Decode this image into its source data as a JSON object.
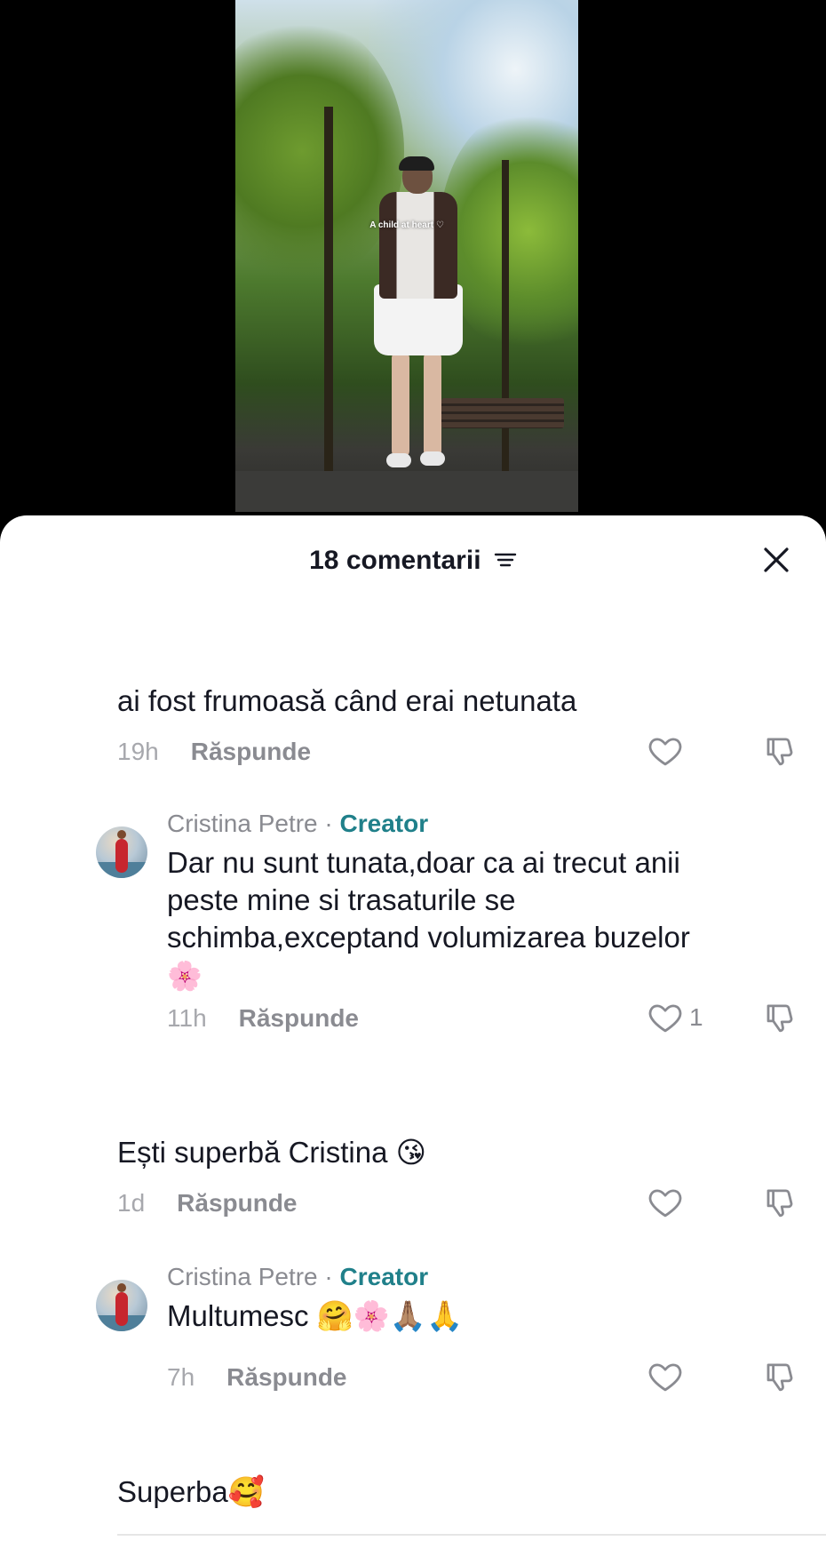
{
  "video": {
    "caption": "A child at heart ♡"
  },
  "sheet": {
    "title": "18 comentarii"
  },
  "comments": [
    {
      "text": "ai fost frumoasă când erai netunata",
      "time": "19h",
      "reply_label": "Răspunde",
      "likes": ""
    },
    {
      "author": "Cristina Petre",
      "badge": "Creator",
      "separator": " · ",
      "text_lines": [
        "Dar nu sunt tunata,doar ca ai trecut anii",
        "peste mine si trasaturile se",
        "schimba,exceptand volumizarea buzelor"
      ],
      "emoji": "🌸",
      "time": "11h",
      "reply_label": "Răspunde",
      "likes": "1"
    },
    {
      "text": "Ești superbă Cristina",
      "emoji": "😘",
      "time": "1d",
      "reply_label": "Răspunde",
      "likes": ""
    },
    {
      "author": "Cristina Petre",
      "badge": "Creator",
      "separator": " · ",
      "text": "Multumesc",
      "emojis": "🤗🌸🙏🏽🙏",
      "time": "7h",
      "reply_label": "Răspunde",
      "likes": ""
    },
    {
      "text": "Superba",
      "emoji": "🥰"
    }
  ],
  "colors": {
    "creator_badge": "#20808a",
    "meta_text": "#8a8b91",
    "primary_text": "#161823"
  },
  "icons": {
    "filter": "filter-icon",
    "close": "close-icon",
    "like": "heart-outline-icon",
    "dislike": "thumbs-down-icon"
  }
}
